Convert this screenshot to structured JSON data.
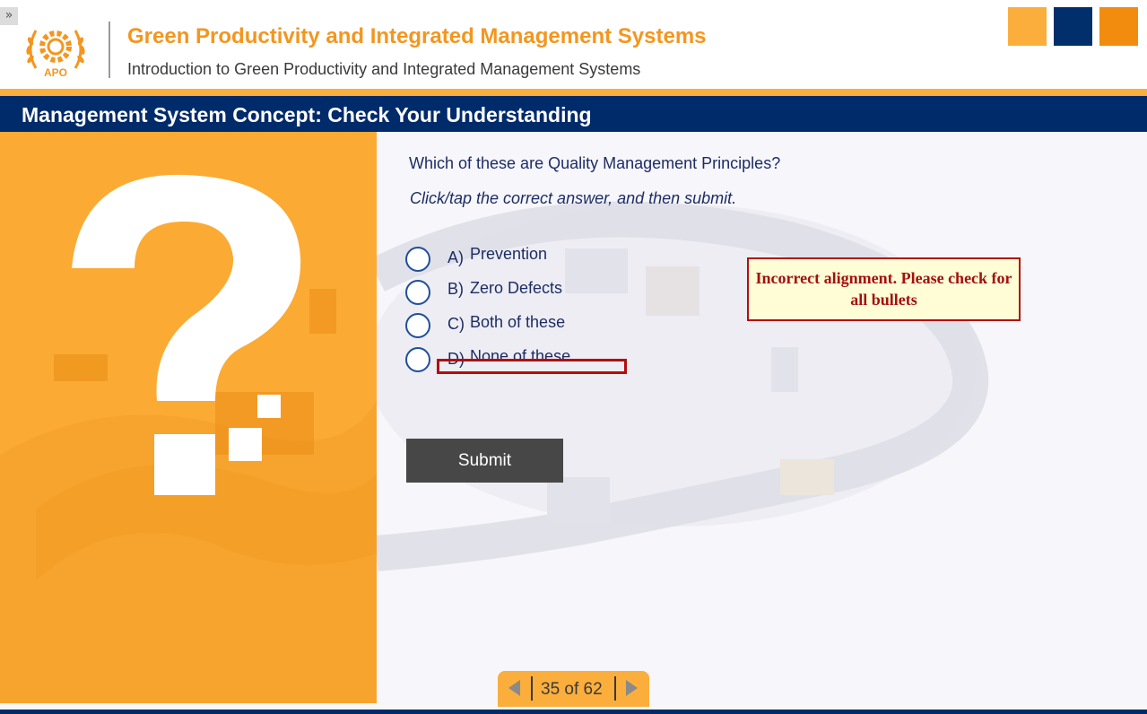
{
  "app": {
    "expand_glyph": "»"
  },
  "header": {
    "logo_text": "APO",
    "logo_icon": "apo-gear-laurel-logo",
    "title": "Green Productivity and Integrated Management Systems",
    "subtitle": "Introduction to Green Productivity and Integrated Management Systems"
  },
  "colors": {
    "brand_orange": "#f4961e",
    "panel_orange": "#fbaa33",
    "navy": "#002b6b",
    "annotation_red": "#b40d0d"
  },
  "slide": {
    "title": "Management System Concept: Check Your Understanding",
    "question": "Which of these are Quality Management Principles?",
    "instruction": "Click/tap the correct answer, and then submit.",
    "options": [
      {
        "letter": "A)",
        "text": "Prevention"
      },
      {
        "letter": "B)",
        "text": "Zero Defects"
      },
      {
        "letter": "C)",
        "text": "Both of these"
      },
      {
        "letter": "D)",
        "text": "None of these"
      }
    ],
    "submit_label": "Submit"
  },
  "annotation": {
    "callout_text": "Incorrect alignment. Please check for all bullets"
  },
  "pager": {
    "current": 35,
    "total": 62,
    "label": "35 of 62"
  }
}
